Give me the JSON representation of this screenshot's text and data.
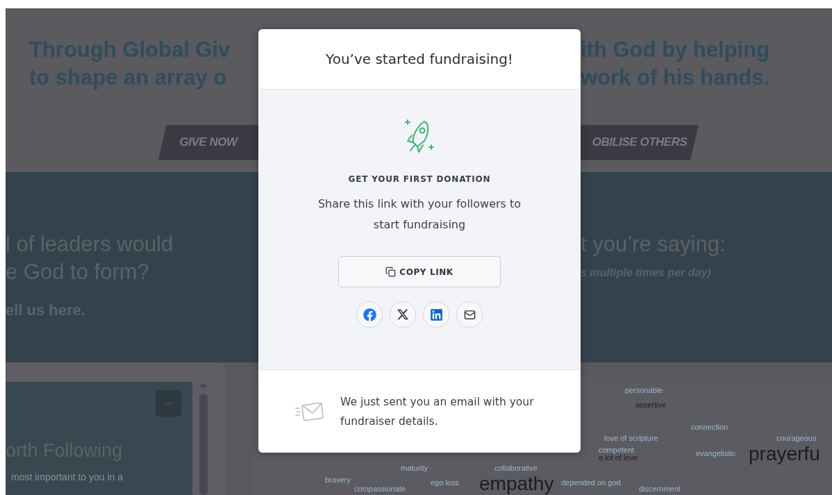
{
  "background_page": {
    "hero": {
      "heading_left": [
        "Through Global Giv",
        "to shape an array o"
      ],
      "heading_right": [
        "ith God by helping",
        "work of his hands."
      ],
      "buttons": [
        "GIVE NOW",
        "OBILISE OTHERS"
      ]
    },
    "question": {
      "left_lines": [
        "l of leaders would",
        "e God to form?"
      ],
      "left_link": "ell us here.",
      "right_heading": "t you’re saying:",
      "right_note": "s multiple times per day)"
    },
    "video_card": {
      "title": "orth Following",
      "text": "most important to you in a",
      "menu": "···"
    },
    "word_cloud": {
      "words": [
        "personable",
        "assertive",
        "connection",
        "love of scripture",
        "courageous",
        "competent",
        "a lot of love",
        "evangelistic",
        "prayerfu",
        "maturity",
        "collaborative",
        "bravery",
        "compassionate",
        "ego loss",
        "empathy",
        "depended on god",
        "discernment"
      ]
    }
  },
  "modal": {
    "title": "You’ve started fundraising!",
    "heading": "GET YOUR FIRST DONATION",
    "message": "Share this link with your followers to start fundraising",
    "copy_button": "COPY LINK",
    "share_buttons": [
      {
        "kind": "facebook"
      },
      {
        "kind": "x"
      },
      {
        "kind": "linkedin"
      },
      {
        "kind": "email"
      }
    ],
    "footer_note": "We just sent you an email with your fundraiser details."
  }
}
